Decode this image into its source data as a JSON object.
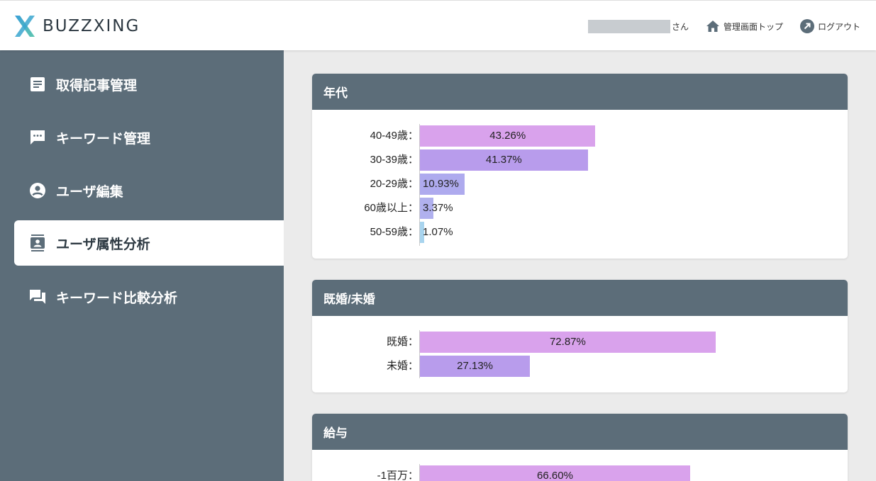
{
  "header": {
    "logo_text": "BUZZXING",
    "user_suffix": "さん",
    "admin_top_label": "管理画面トップ",
    "logout_label": "ログアウト"
  },
  "sidebar": {
    "items": [
      {
        "label": "取得記事管理",
        "icon": "article-icon"
      },
      {
        "label": "キーワード管理",
        "icon": "chat-bubble-icon"
      },
      {
        "label": "ユーザ編集",
        "icon": "account-circle-icon"
      },
      {
        "label": "ユーザ属性分析",
        "icon": "contact-card-icon",
        "active": true
      },
      {
        "label": "キーワード比較分析",
        "icon": "forum-icon"
      }
    ]
  },
  "colors": {
    "sidebar_bg": "#5c6d79",
    "bar_pink": "#d9a2ec",
    "bar_violet": "#b89cec",
    "bar_periwinkle": "#aeaaee",
    "bar_lilac": "#b0b0ee",
    "bar_sky": "#a8d4ee"
  },
  "sections": [
    {
      "title": "年代",
      "rows": [
        {
          "label": "40-49歳：",
          "value": 43.26,
          "value_text": "43.26%",
          "color": "#d9a2ec"
        },
        {
          "label": "30-39歳：",
          "value": 41.37,
          "value_text": "41.37%",
          "color": "#b89cec"
        },
        {
          "label": "20-29歳：",
          "value": 10.93,
          "value_text": "10.93%",
          "color": "#aeaaee"
        },
        {
          "label": "60歳以上：",
          "value": 3.37,
          "value_text": "3.37%",
          "color": "#b0b0ee"
        },
        {
          "label": "50-59歳：",
          "value": 1.07,
          "value_text": "1.07%",
          "color": "#a8d4ee"
        }
      ]
    },
    {
      "title": "既婚/未婚",
      "rows": [
        {
          "label": "既婚：",
          "value": 72.87,
          "value_text": "72.87%",
          "color": "#d9a2ec"
        },
        {
          "label": "未婚：",
          "value": 27.13,
          "value_text": "27.13%",
          "color": "#b89cec"
        }
      ]
    },
    {
      "title": "給与",
      "rows": [
        {
          "label": "-1百万：",
          "value": 66.6,
          "value_text": "66.60%",
          "color": "#d9a2ec"
        }
      ]
    }
  ]
}
